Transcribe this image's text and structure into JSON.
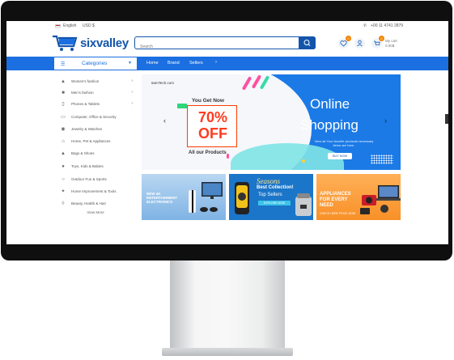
{
  "topbar": {
    "language": "English",
    "currency": "USD $",
    "phone": "+00 11 4741 2879"
  },
  "header": {
    "logo": "sixvalley",
    "search_placeholder": "Search",
    "wishlist_count": "0",
    "compare_count": "0",
    "cart_count": "0",
    "cart_label": "My cart",
    "cart_total": "0.00$"
  },
  "navbar": {
    "categories_label": "Categories",
    "links": [
      "Home",
      "Brand",
      "Sellers"
    ]
  },
  "sidebar": {
    "items": [
      {
        "label": "Women's fashion",
        "icon": "dress-icon"
      },
      {
        "label": "Men's fashion",
        "icon": "shirt-icon"
      },
      {
        "label": "Phones & Tablets",
        "icon": "phone-icon"
      },
      {
        "label": "Computer, Office & Security",
        "icon": "computer-icon"
      },
      {
        "label": "Jewelry & Watches",
        "icon": "watch-icon"
      },
      {
        "label": "Home, Pet & Appliances",
        "icon": "home-icon"
      },
      {
        "label": "Bags & Shoes",
        "icon": "bag-icon"
      },
      {
        "label": "Toys, Kids & Babies",
        "icon": "toy-icon"
      },
      {
        "label": "Outdoor Fun & Sports",
        "icon": "sport-icon"
      },
      {
        "label": "Home Improvement & Tools",
        "icon": "tools-icon"
      },
      {
        "label": "Beauty, Health & Hair",
        "icon": "beauty-icon"
      }
    ],
    "view_more": "View More"
  },
  "banner": {
    "shop_name": "6amTech.com",
    "you_get": "You Get Now",
    "percent": "70%",
    "off": "OFF",
    "all_products": "All our Products",
    "online": "Online",
    "shopping": "Shopping",
    "subtitle": "View all Your favorite products necessary items are here.",
    "buy_now": "BUY NOW"
  },
  "small_banners": {
    "b1": "NEW 4K ENTERTAINMENT ELECTRONICS",
    "b2_title": "Seasons",
    "b2_best": "Best Collection!",
    "b2_top": "Top Sellers",
    "b2_cta": "EXPLORE NOW",
    "b3_title": "APPLIANCES FOR EVERY NEED",
    "b3_sub": "CHECK HERE PRICE NOW"
  },
  "colors": {
    "primary": "#1b6fe0",
    "brand_dark": "#1455ac",
    "offer": "#ff3b1f",
    "badge": "#f58300"
  }
}
